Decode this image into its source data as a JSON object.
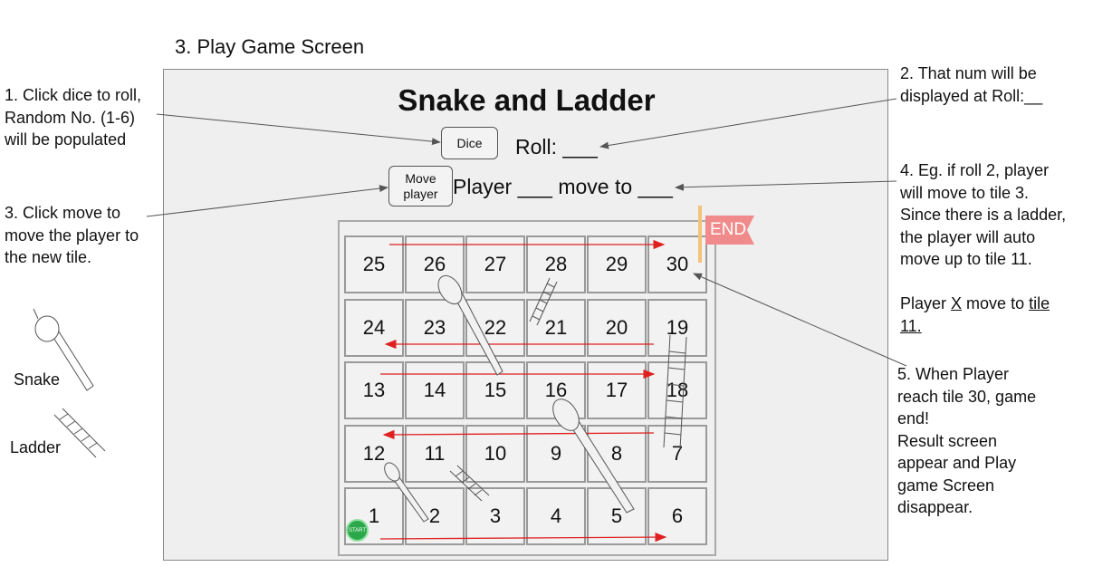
{
  "screen_title": "3. Play Game Screen",
  "game": {
    "title": "Snake and Ladder",
    "dice_label": "Dice",
    "move_label_line1": "Move",
    "move_label_line2": "player",
    "roll_text": "Roll: ___",
    "player_text": "Player ___ move to ___"
  },
  "board": {
    "rows": [
      [
        "25",
        "26",
        "27",
        "28",
        "29",
        "30"
      ],
      [
        "24",
        "23",
        "22",
        "21",
        "20",
        "19"
      ],
      [
        "13",
        "14",
        "15",
        "16",
        "17",
        "18"
      ],
      [
        "12",
        "11",
        "10",
        "9",
        "8",
        "7"
      ],
      [
        "1",
        "2",
        "3",
        "4",
        "5",
        "6"
      ]
    ],
    "end_label": "END",
    "start_label": "START"
  },
  "legend": {
    "snake_label": "Snake",
    "ladder_label": "Ladder"
  },
  "notes": {
    "n1": [
      "1. Click dice to roll,",
      "Random No. (1-6)",
      "will be populated"
    ],
    "n2": [
      "2. That num will be",
      "displayed at Roll:__"
    ],
    "n3": [
      "3. Click move to",
      "move the player to",
      "the new tile."
    ],
    "n4": [
      "4. Eg. if roll 2, player",
      "will move to tile 3.",
      "Since there is a ladder,",
      "the player will auto",
      "move up to tile 11."
    ],
    "n4_example": {
      "prefix": "Player ",
      "x": "X",
      "middle": " move to ",
      "tile": "tile",
      "num": "11."
    },
    "n5": [
      "5. When Player",
      "reach tile 30, game",
      "end!",
      "Result screen",
      "appear and Play",
      "game Screen",
      "disappear."
    ]
  },
  "colors": {
    "arrow_red": "#e02020",
    "start_green": "#2aa84a",
    "end_flag": "#f18a8a"
  }
}
